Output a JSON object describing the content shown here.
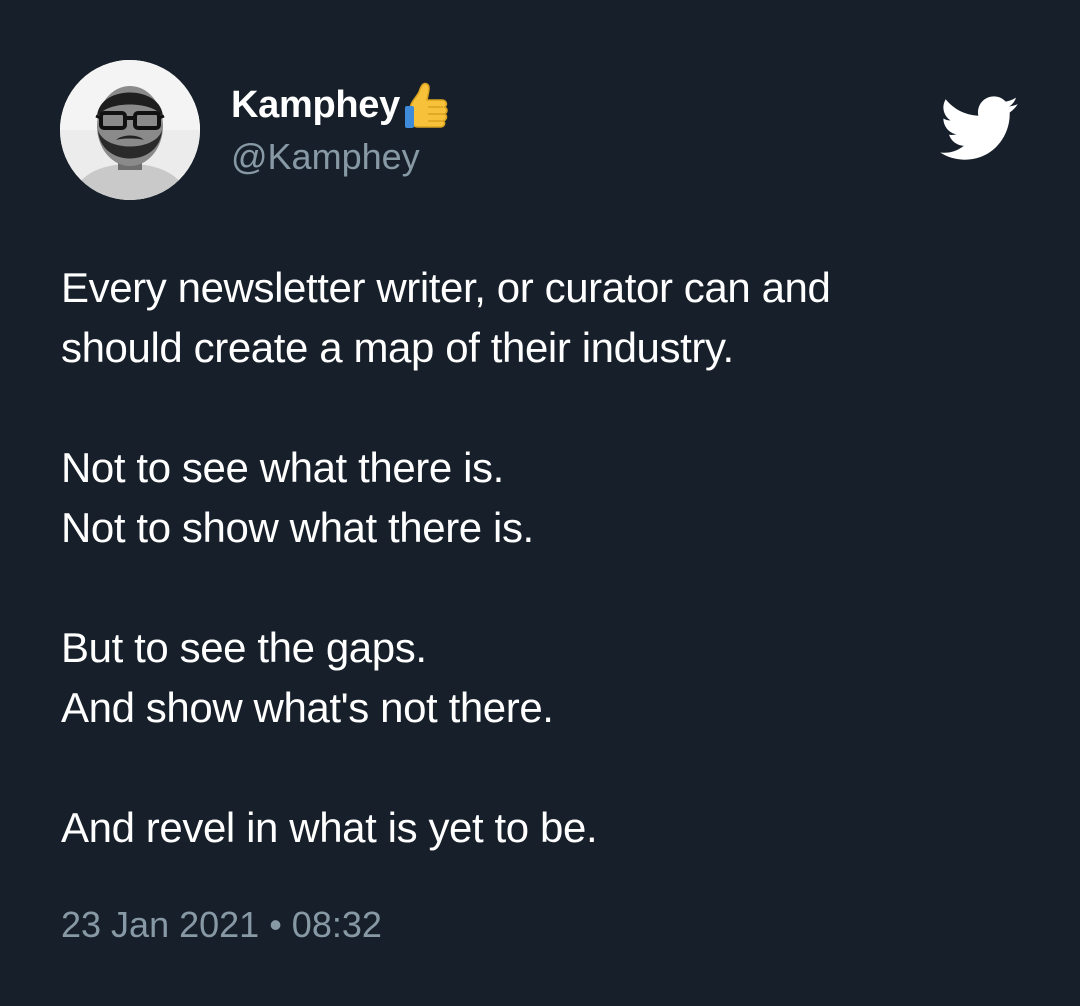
{
  "user": {
    "display_name": "Kamphey",
    "handle": "@Kamphey",
    "badge_icon": "thumbs-up-icon",
    "avatar_icon": "avatar"
  },
  "brand": {
    "logo_icon": "twitter-bird-icon",
    "logo_color": "#ffffff"
  },
  "tweet": {
    "lines": [
      "Every newsletter writer, or curator can and",
      "should create a map of their industry.",
      "",
      "Not to see what there is.",
      "Not to show what there is.",
      "",
      "But to see the gaps.",
      "And show what's not there.",
      "",
      "And revel in what is yet to be."
    ]
  },
  "meta": {
    "date": "23 Jan 2021",
    "separator": "•",
    "time": "08:32"
  },
  "colors": {
    "background": "#17202a",
    "primary_text": "#ffffff",
    "secondary_text": "#8899a6",
    "badge_yellow": "#f7c13a"
  }
}
